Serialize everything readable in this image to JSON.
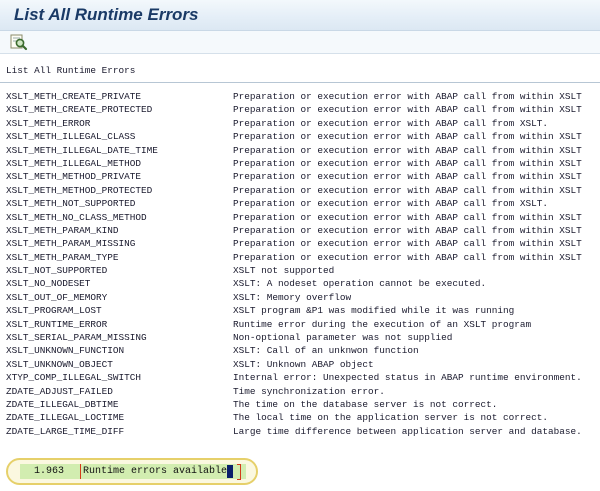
{
  "window": {
    "title": "List All Runtime Errors"
  },
  "toolbar": {
    "find_icon": "find-magnifier-icon"
  },
  "list": {
    "header": "List All Runtime Errors",
    "rows": [
      {
        "code": "XSLT_METH_CREATE_PRIVATE",
        "desc": "Preparation or execution error with ABAP call from within XSLT"
      },
      {
        "code": "XSLT_METH_CREATE_PROTECTED",
        "desc": "Preparation or execution error with ABAP call from within XSLT"
      },
      {
        "code": "XSLT_METH_ERROR",
        "desc": "Preparation or execution error with ABAP call from XSLT."
      },
      {
        "code": "XSLT_METH_ILLEGAL_CLASS",
        "desc": "Preparation or execution error with ABAP call from within XSLT"
      },
      {
        "code": "XSLT_METH_ILLEGAL_DATE_TIME",
        "desc": "Preparation or execution error with ABAP call from within XSLT"
      },
      {
        "code": "XSLT_METH_ILLEGAL_METHOD",
        "desc": "Preparation or execution error with ABAP call from within XSLT"
      },
      {
        "code": "XSLT_METH_METHOD_PRIVATE",
        "desc": "Preparation or execution error with ABAP call from within XSLT"
      },
      {
        "code": "XSLT_METH_METHOD_PROTECTED",
        "desc": "Preparation or execution error with ABAP call from within XSLT"
      },
      {
        "code": "XSLT_METH_NOT_SUPPORTED",
        "desc": "Preparation or execution error with ABAP call from XSLT."
      },
      {
        "code": "XSLT_METH_NO_CLASS_METHOD",
        "desc": "Preparation or execution error with ABAP call from within XSLT"
      },
      {
        "code": "XSLT_METH_PARAM_KIND",
        "desc": "Preparation or execution error with ABAP call from within XSLT"
      },
      {
        "code": "XSLT_METH_PARAM_MISSING",
        "desc": "Preparation or execution error with ABAP call from within XSLT"
      },
      {
        "code": "XSLT_METH_PARAM_TYPE",
        "desc": "Preparation or execution error with ABAP call from within XSLT"
      },
      {
        "code": "XSLT_NOT_SUPPORTED",
        "desc": "XSLT not supported"
      },
      {
        "code": "XSLT_NO_NODESET",
        "desc": "XSLT: A nodeset operation cannot be executed."
      },
      {
        "code": "XSLT_OUT_OF_MEMORY",
        "desc": "XSLT: Memory overflow"
      },
      {
        "code": "XSLT_PROGRAM_LOST",
        "desc": "XSLT program &P1 was modified while it was running"
      },
      {
        "code": "XSLT_RUNTIME_ERROR",
        "desc": "Runtime error during the execution of an XSLT program"
      },
      {
        "code": "XSLT_SERIAL_PARAM_MISSING",
        "desc": "Non-optional parameter was not supplied"
      },
      {
        "code": "XSLT_UNKNOWN_FUNCTION",
        "desc": "XSLT: Call of an unknwon function"
      },
      {
        "code": "XSLT_UNKNOWN_OBJECT",
        "desc": "XSLT: Unknown ABAP object"
      },
      {
        "code": "XTYP_COMP_ILLEGAL_SWITCH",
        "desc": "Internal error: Unexpected status in ABAP runtime environment."
      },
      {
        "code": "ZDATE_ADJUST_FAILED",
        "desc": "Time synchronization error."
      },
      {
        "code": "ZDATE_ILLEGAL_DBTIME",
        "desc": "The time on the database server is not correct."
      },
      {
        "code": "ZDATE_ILLEGAL_LOCTIME",
        "desc": "The local time on the application server is not correct."
      },
      {
        "code": "ZDATE_LARGE_TIME_DIFF",
        "desc": "Large time difference between application server and database."
      }
    ]
  },
  "status": {
    "count": "1.963",
    "message": "Runtime errors available"
  },
  "colors": {
    "title_text": "#1a3a66",
    "status_field_bg": "#d2edb0",
    "highlight_ring": "#e6d06a"
  }
}
